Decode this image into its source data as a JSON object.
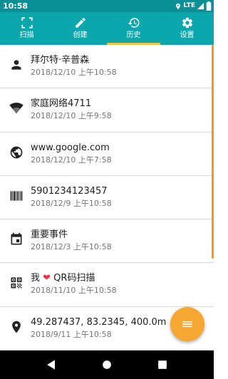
{
  "status": {
    "time": "10:58",
    "network": "LTE"
  },
  "tabs": [
    {
      "label": "扫描",
      "icon": "scan-frame-icon"
    },
    {
      "label": "创建",
      "icon": "pencil-icon"
    },
    {
      "label": "历史",
      "icon": "history-icon",
      "active": true
    },
    {
      "label": "设置",
      "icon": "gear-icon"
    }
  ],
  "history": [
    {
      "icon": "person-icon",
      "title": "拜尔特·辛普森",
      "date": "2018/12/10 上午10:58"
    },
    {
      "icon": "wifi-icon",
      "title": "家庭网络4711",
      "date": "2018/12/10 上午9:58"
    },
    {
      "icon": "globe-icon",
      "title": "www.google.com",
      "date": "2018/12/10 上午7:58"
    },
    {
      "icon": "barcode-icon",
      "title": "5901234123457",
      "date": "2018/12/9 上午10:58"
    },
    {
      "icon": "calendar-icon",
      "title": "重要事件",
      "date": "2018/12/3 上午10:58"
    },
    {
      "icon": "qr-code-icon",
      "title_prefix": "我 ",
      "title_suffix": " QR码扫描",
      "date": "2018/11/10 上午10:58"
    },
    {
      "icon": "location-pin-icon",
      "title": "49.287437, 83.2345, 400.0m",
      "date": "2018/9/11 上午10:58"
    }
  ],
  "fab": {
    "icon": "menu-lines-icon"
  },
  "navigation": {
    "back": "back-triangle-icon",
    "home": "home-circle-icon",
    "recents": "recents-square-icon"
  },
  "colors": {
    "status_bar": "#0a8f95",
    "tab_bar": "#0ba7ad",
    "tab_indicator": "#f5c542",
    "fab": "#f5a731",
    "heart": "#e53945"
  }
}
